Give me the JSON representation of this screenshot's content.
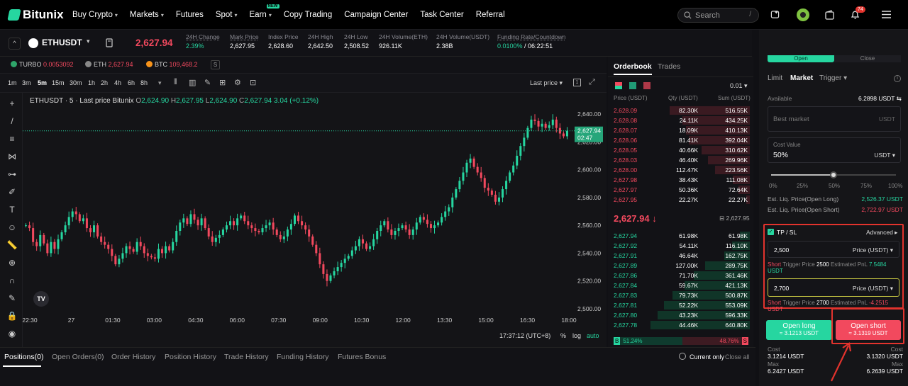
{
  "brand": "Bitunix",
  "nav": [
    {
      "label": "Buy Crypto",
      "caret": true
    },
    {
      "label": "Markets",
      "caret": true
    },
    {
      "label": "Futures",
      "caret": false
    },
    {
      "label": "Spot",
      "caret": true
    },
    {
      "label": "Earn",
      "caret": true,
      "badge": "NEW"
    },
    {
      "label": "Copy Trading",
      "caret": false
    },
    {
      "label": "Campaign Center",
      "caret": false
    },
    {
      "label": "Task Center",
      "caret": false
    },
    {
      "label": "Referral",
      "caret": false
    }
  ],
  "search": {
    "placeholder": "Search",
    "shortcut": "/"
  },
  "notif_count": "74",
  "symbol": "ETHUSDT",
  "last_price": "2,627.94",
  "stats": [
    {
      "label": "24H Change",
      "value": "2.39%",
      "color": "#26d6a0"
    },
    {
      "label": "Mark Price",
      "value": "2,627.95"
    },
    {
      "label": "Index Price",
      "value": "2,628.60"
    },
    {
      "label": "24H High",
      "value": "2,642.50"
    },
    {
      "label": "24H Low",
      "value": "2,508.52"
    },
    {
      "label": "24H Volume(ETH)",
      "value": "926.11K"
    },
    {
      "label": "24H Volume(USDT)",
      "value": "2.38B"
    }
  ],
  "funding": {
    "label": "Funding Rate/Countdown",
    "rate": "0.0100%",
    "countdown": "/ 06:22:51"
  },
  "marquee": [
    {
      "sym": "TURBO",
      "val": "0.0053092"
    },
    {
      "sym": "ETH",
      "val": "2,627.94"
    },
    {
      "sym": "BTC",
      "val": "109,468.2"
    }
  ],
  "timeframes": [
    "1m",
    "3m",
    "5m",
    "15m",
    "30m",
    "1h",
    "2h",
    "4h",
    "6h",
    "8h"
  ],
  "active_tf": "5m",
  "chart_price_type": "Last price",
  "chart_header": {
    "title": "ETHUSDT · 5 · Last price Bitunix",
    "o": "2,624.90",
    "h": "2,627.95",
    "l": "2,624.90",
    "c": "2,627.94",
    "chg": "3.04 (+0.12%)"
  },
  "chart_data": {
    "type": "candlestick",
    "y_ticks": [
      "2,640.00",
      "2,620.00",
      "2,600.00",
      "2,580.00",
      "2,560.00",
      "2,540.00",
      "2,520.00",
      "2,500.00"
    ],
    "ylim": [
      2500,
      2640
    ],
    "x_ticks": [
      "22:30",
      "27",
      "01:30",
      "03:00",
      "04:30",
      "06:00",
      "07:30",
      "09:00",
      "10:30",
      "12:00",
      "13:30",
      "15:00",
      "16:30",
      "18:00"
    ],
    "last_price_label": "2,627.94",
    "countdown_label": "02:47",
    "closes": [
      2560,
      2558,
      2548,
      2545,
      2553,
      2547,
      2540,
      2548,
      2543,
      2550,
      2555,
      2560,
      2566,
      2570,
      2568,
      2563,
      2565,
      2558,
      2555,
      2560,
      2552,
      2548,
      2546,
      2543,
      2538,
      2532,
      2536,
      2540,
      2545,
      2543,
      2541,
      2548,
      2545,
      2540,
      2538,
      2537,
      2536,
      2543,
      2540,
      2545,
      2542,
      2548,
      2556,
      2562,
      2565,
      2561,
      2568,
      2564,
      2560,
      2565,
      2558,
      2552,
      2548,
      2551,
      2553,
      2557,
      2560,
      2563,
      2560,
      2565,
      2567,
      2563,
      2560,
      2558,
      2556,
      2555,
      2558,
      2560,
      2562,
      2557,
      2553,
      2550,
      2552,
      2557,
      2561,
      2567,
      2563,
      2560,
      2557,
      2552,
      2546,
      2540,
      2532,
      2525,
      2520,
      2524,
      2527,
      2530,
      2533,
      2536,
      2538,
      2542,
      2545,
      2550,
      2547,
      2543,
      2545,
      2550,
      2556,
      2560,
      2563,
      2557,
      2553,
      2556,
      2558,
      2560,
      2557,
      2553,
      2557,
      2562,
      2566,
      2564,
      2561,
      2558,
      2560,
      2562,
      2566,
      2570,
      2573,
      2580,
      2586,
      2592,
      2598,
      2605,
      2608,
      2602,
      2598,
      2594,
      2587,
      2585,
      2582,
      2577,
      2580,
      2586,
      2592,
      2598,
      2603,
      2610,
      2617,
      2623,
      2630,
      2636,
      2635,
      2631,
      2633,
      2630,
      2632,
      2636,
      2630,
      2626,
      2624,
      2627.94
    ]
  },
  "chart_footer": {
    "time": "17:37:12 (UTC+8)",
    "pct": "%",
    "log": "log",
    "auto": "auto"
  },
  "orderbook": {
    "tabs": [
      "Orderbook",
      "Trades"
    ],
    "precision": "0.01",
    "headers": [
      "Price (USDT)",
      "Qty (USDT)",
      "Sum (USDT)"
    ],
    "asks": [
      [
        "2,628.09",
        "82.30K",
        "516.55K"
      ],
      [
        "2,628.08",
        "24.11K",
        "434.25K"
      ],
      [
        "2,628.07",
        "18.09K",
        "410.13K"
      ],
      [
        "2,628.06",
        "81.41K",
        "392.04K"
      ],
      [
        "2,628.05",
        "40.66K",
        "310.62K"
      ],
      [
        "2,628.03",
        "46.40K",
        "269.96K"
      ],
      [
        "2,628.00",
        "112.47K",
        "223.56K"
      ],
      [
        "2,627.98",
        "38.43K",
        "111.08K"
      ],
      [
        "2,627.97",
        "50.36K",
        "72.64K"
      ],
      [
        "2,627.95",
        "22.27K",
        "22.27K"
      ]
    ],
    "mid_price": "2,627.94 ↓",
    "mid_mark": "2,627.95",
    "bids": [
      [
        "2,627.94",
        "61.98K",
        "61.98K"
      ],
      [
        "2,627.92",
        "54.11K",
        "116.10K"
      ],
      [
        "2,627.91",
        "46.64K",
        "162.75K"
      ],
      [
        "2,627.89",
        "127.00K",
        "289.75K"
      ],
      [
        "2,627.86",
        "71.70K",
        "361.46K"
      ],
      [
        "2,627.84",
        "59.67K",
        "421.13K"
      ],
      [
        "2,627.83",
        "79.73K",
        "500.87K"
      ],
      [
        "2,627.81",
        "52.22K",
        "553.09K"
      ],
      [
        "2,627.80",
        "43.23K",
        "596.33K"
      ],
      [
        "2,627.78",
        "44.46K",
        "640.80K"
      ]
    ],
    "ratio": {
      "buy_tag": "B",
      "buy": "51.24%",
      "sell": "48.76%",
      "sell_tag": "S",
      "buy_frac": 0.5124
    }
  },
  "trade": {
    "side_tabs": [
      "Open",
      "Close"
    ],
    "order_types": [
      "Limit",
      "Market",
      "Trigger"
    ],
    "active_type": "Market",
    "available_label": "Available",
    "available_value": "6.2898 USDT",
    "price_placeholder": "Best market",
    "price_unit": "USDT",
    "cost_label": "Cost Value",
    "cost_pct": "50%",
    "cost_unit": "USDT",
    "slider_marks": [
      "0%",
      "25%",
      "50%",
      "75%",
      "100%"
    ],
    "slider_value": 0.5,
    "liq_long_label": "Est. Liq. Price(Open Long)",
    "liq_long": "2,526.37 USDT",
    "liq_short_label": "Est. Liq. Price(Open Short)",
    "liq_short": "2,722.97 USDT",
    "tpsl_label": "TP / SL",
    "advanced": "Advanced",
    "tp_value": "2,500",
    "tp_type": "Price (USDT)",
    "tp_note": {
      "side": "Short",
      "trigger_label": "Trigger Price",
      "trigger": "2500",
      "pnl_label": "Estimated PnL",
      "pnl": "7.5484",
      "unit": "USDT"
    },
    "sl_value": "2,700",
    "sl_type": "Price (USDT)",
    "sl_note": {
      "side": "Short",
      "trigger_label": "Trigger Price",
      "trigger": "2700",
      "pnl_label": "Estimated PnL",
      "pnl": "-4.2515",
      "unit": "USDT"
    },
    "open_long": "Open long",
    "open_long_sub": "≈ 3.1213 USDT",
    "open_short": "Open short",
    "open_short_sub": "≈ 3.1319 USDT",
    "cost_l": "Cost",
    "cost_l_val": "3.1214 USDT",
    "cost_r": "Cost",
    "cost_r_val": "3.1320 USDT",
    "max_l": "Max",
    "max_l_val": "6.2427 USDT",
    "max_r": "Max",
    "max_r_val": "6.2639 USDT"
  },
  "bottom_tabs": [
    "Positions(0)",
    "Open Orders(0)",
    "Order History",
    "Position History",
    "Trade History",
    "Funding History",
    "Futures Bonus"
  ],
  "current_only": "Current only",
  "close_all": "Close all",
  "colors": {
    "green": "#26d6a0",
    "red": "#f2495e",
    "highlight": "#e2332d"
  }
}
